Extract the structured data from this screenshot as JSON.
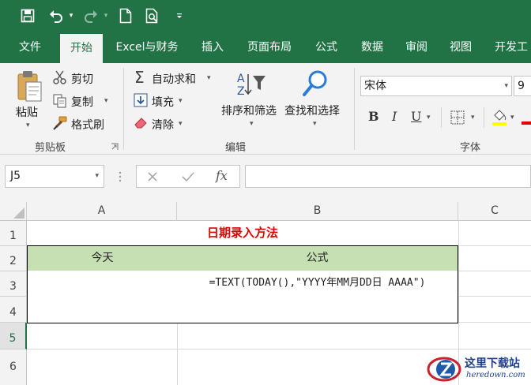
{
  "ribbon_tabs": [
    "文件",
    "开始",
    "Excel与财务",
    "插入",
    "页面布局",
    "公式",
    "数据",
    "审阅",
    "视图",
    "开发工"
  ],
  "clipboard": {
    "paste": "粘贴",
    "cut": "剪切",
    "copy": "复制",
    "format_painter": "格式刷",
    "group_label": "剪贴板"
  },
  "editing": {
    "autosum": "自动求和",
    "fill": "填充",
    "clear": "清除",
    "sort_filter": "排序和筛选",
    "find_select": "查找和选择",
    "group_label": "编辑"
  },
  "font": {
    "name": "宋体",
    "size": "9",
    "group_label": "字体"
  },
  "formula_bar": {
    "name_box": "J5",
    "fx": "fx",
    "formula": ""
  },
  "columns": [
    "A",
    "B",
    "C"
  ],
  "rows": [
    "1",
    "2",
    "3",
    "4",
    "5",
    "6"
  ],
  "cells": {
    "title": "日期录入方法",
    "A2": "今天",
    "B2": "公式",
    "A3": "",
    "B3": "=TEXT(TODAY(),\"YYYY年MM月DD日 AAAA\")",
    "A4": "",
    "B4": ""
  },
  "watermark": {
    "name": "这里下载站",
    "url": "heredown.com"
  },
  "colors": {
    "excel_green": "#217346",
    "header_fill": "#c6e0b4",
    "title_red": "#e00000"
  }
}
